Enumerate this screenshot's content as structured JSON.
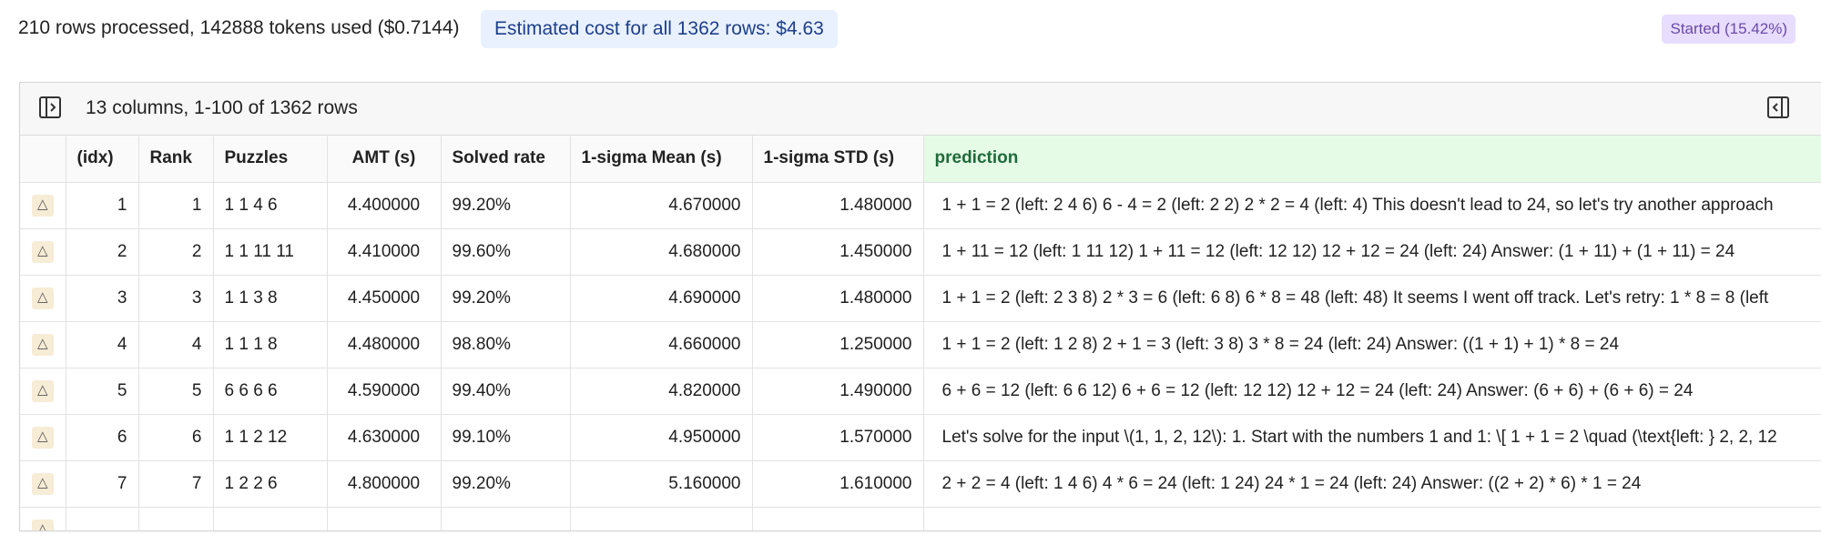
{
  "topbar": {
    "progress_text": "210 rows processed, 142888 tokens used ($0.7144)",
    "estimate_text": "Estimated cost for all 1362 rows: $4.63",
    "status_text": "Started (15.42%)"
  },
  "panel": {
    "summary": "13 columns, 1-100 of 1362 rows",
    "toggle_left_icon": "panel-collapse-left-icon",
    "toggle_right_icon": "panel-collapse-right-icon"
  },
  "columns": [
    "",
    "(idx)",
    "Rank",
    "Puzzles",
    "AMT (s)",
    "Solved rate",
    "1-sigma Mean (s)",
    "1-sigma STD (s)",
    "prediction"
  ],
  "rows": [
    {
      "idx": "1",
      "rank": "1",
      "puzzles": "1 1 4 6",
      "amt": "4.400000",
      "solved": "99.20%",
      "mean": "4.670000",
      "std": "1.480000",
      "prediction": "1 + 1 = 2 (left: 2 4 6) 6 - 4 = 2 (left: 2 2) 2 * 2 = 4 (left: 4) This doesn't lead to 24, so let's try another approach"
    },
    {
      "idx": "2",
      "rank": "2",
      "puzzles": "1 1 11 11",
      "amt": "4.410000",
      "solved": "99.60%",
      "mean": "4.680000",
      "std": "1.450000",
      "prediction": "1 + 11 = 12 (left: 1 11 12) 1 + 11 = 12 (left: 12 12) 12 + 12 = 24 (left: 24) Answer: (1 + 11) + (1 + 11) = 24"
    },
    {
      "idx": "3",
      "rank": "3",
      "puzzles": "1 1 3 8",
      "amt": "4.450000",
      "solved": "99.20%",
      "mean": "4.690000",
      "std": "1.480000",
      "prediction": "1 + 1 = 2 (left: 2 3 8) 2 * 3 = 6 (left: 6 8) 6 * 8 = 48 (left: 48) It seems I went off track. Let's retry: 1 * 8 = 8 (left"
    },
    {
      "idx": "4",
      "rank": "4",
      "puzzles": "1 1 1 8",
      "amt": "4.480000",
      "solved": "98.80%",
      "mean": "4.660000",
      "std": "1.250000",
      "prediction": "1 + 1 = 2 (left: 1 2 8) 2 + 1 = 3 (left: 3 8) 3 * 8 = 24 (left: 24) Answer: ((1 + 1) + 1) * 8 = 24"
    },
    {
      "idx": "5",
      "rank": "5",
      "puzzles": "6 6 6 6",
      "amt": "4.590000",
      "solved": "99.40%",
      "mean": "4.820000",
      "std": "1.490000",
      "prediction": "6 + 6 = 12 (left: 6 6 12) 6 + 6 = 12 (left: 12 12) 12 + 12 = 24 (left: 24) Answer: (6 + 6) + (6 + 6) = 24"
    },
    {
      "idx": "6",
      "rank": "6",
      "puzzles": "1 1 2 12",
      "amt": "4.630000",
      "solved": "99.10%",
      "mean": "4.950000",
      "std": "1.570000",
      "prediction": "Let's solve for the input \\(1, 1, 2, 12\\): 1. Start with the numbers 1 and 1: \\[ 1 + 1 = 2 \\quad (\\text{left: } 2, 2, 12"
    },
    {
      "idx": "7",
      "rank": "7",
      "puzzles": "1 2 2 6",
      "amt": "4.800000",
      "solved": "99.20%",
      "mean": "5.160000",
      "std": "1.610000",
      "prediction": "2 + 2 = 4 (left: 1 4 6) 4 * 6 = 24 (left: 1 24) 24 * 1 = 24 (left: 24) Answer: ((2 + 2) * 6) * 1 = 24"
    },
    {
      "idx": "",
      "rank": "",
      "puzzles": "",
      "amt": "",
      "solved": "",
      "mean": "",
      "std": "",
      "prediction": ""
    }
  ],
  "row_icon": "expand-triangle-icon",
  "colors": {
    "estimate_bg": "#e9f1ff",
    "status_bg": "#e8dcff",
    "prediction_header_bg": "#e5fbe6",
    "row_icon_bg": "#f7ecd6"
  }
}
